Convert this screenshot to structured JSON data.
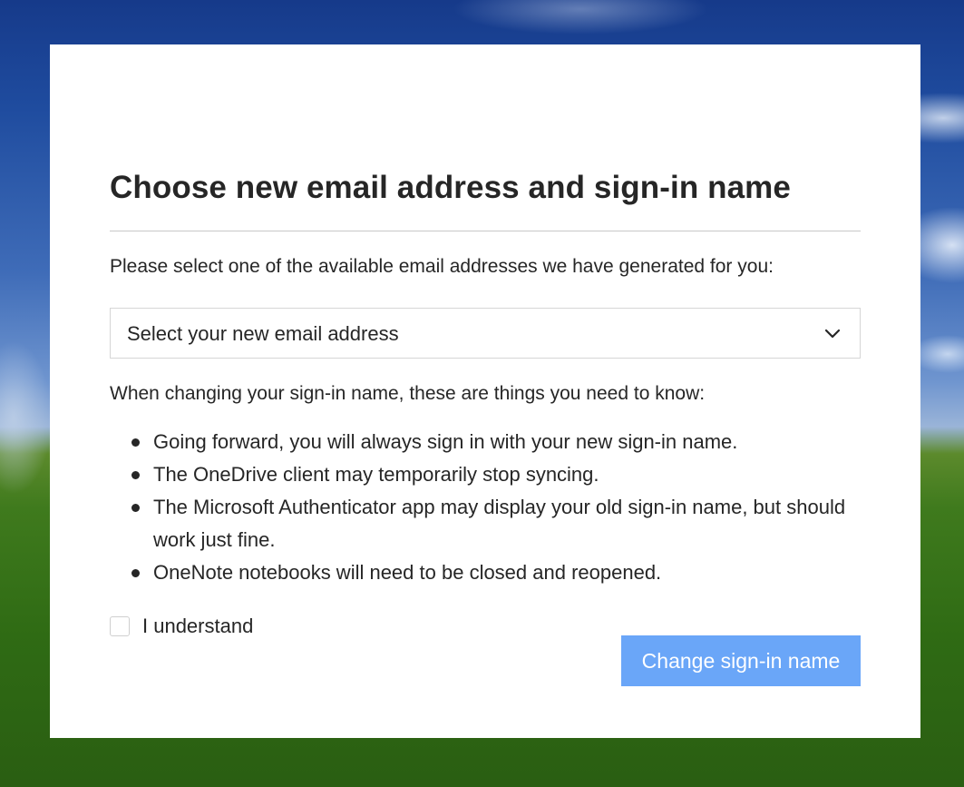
{
  "dialog": {
    "title": "Choose new email address and sign-in name",
    "intro": "Please select one of the available email addresses we have generated for you:",
    "select": {
      "placeholder": "Select your new email address",
      "icon": "chevron-down-icon"
    },
    "notice": "When changing your sign-in name, these are things you need to know:",
    "bullets": [
      "Going forward, you will always sign in with your new sign-in name.",
      "The OneDrive client may temporarily stop syncing.",
      "The Microsoft Authenticator app may display your old sign-in name, but should work just fine.",
      "OneNote notebooks will need to be closed and reopened."
    ],
    "checkbox": {
      "label": "I understand",
      "checked": false
    },
    "submit_label": "Change sign-in name"
  },
  "colors": {
    "button": "#6aa6f8",
    "text": "#262626",
    "divider": "#c8c8c8"
  }
}
